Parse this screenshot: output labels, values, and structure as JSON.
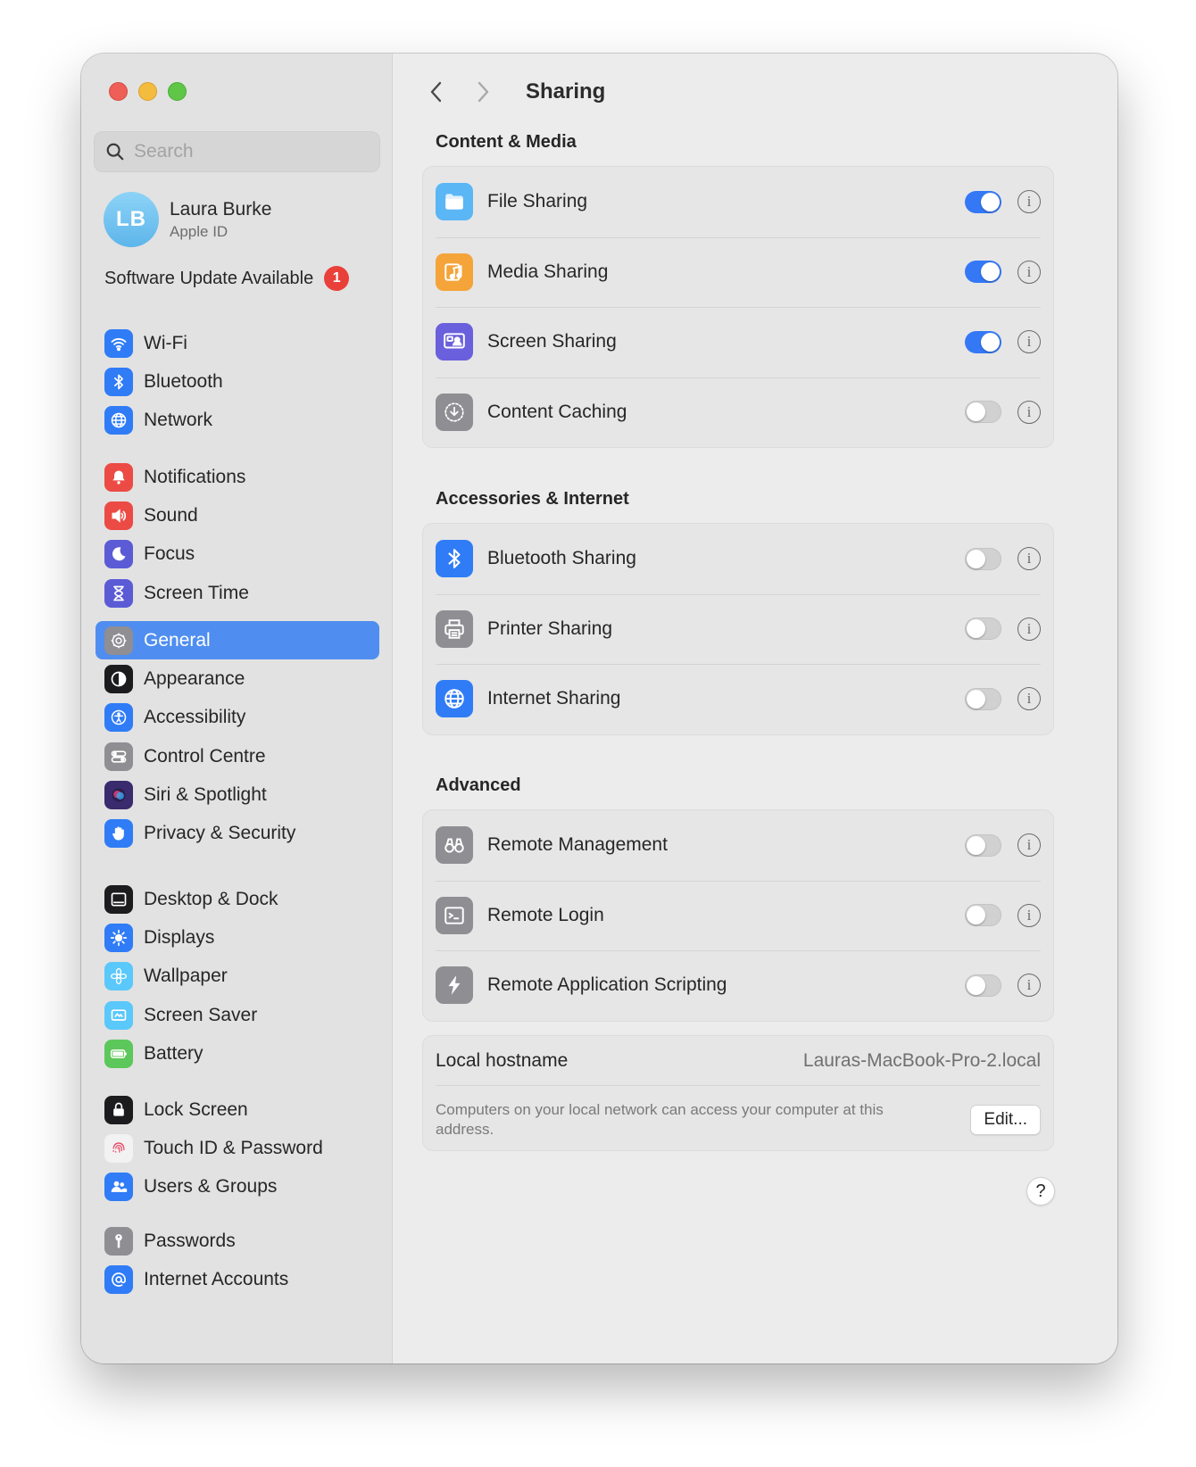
{
  "window": {
    "title": "Sharing"
  },
  "sidebar": {
    "search_placeholder": "Search",
    "profile": {
      "initials": "LB",
      "name": "Laura Burke",
      "subtitle": "Apple ID"
    },
    "update": {
      "label": "Software Update Available",
      "count": "1"
    },
    "groups": [
      [
        {
          "label": "Wi-Fi",
          "icon": "wifi-icon",
          "color": "#2f7cf6"
        },
        {
          "label": "Bluetooth",
          "icon": "bluetooth-icon",
          "color": "#2f7cf6"
        },
        {
          "label": "Network",
          "icon": "globe-icon",
          "color": "#2f7cf6"
        }
      ],
      [
        {
          "label": "Notifications",
          "icon": "bell-icon",
          "color": "#ec4b45"
        },
        {
          "label": "Sound",
          "icon": "speaker-icon",
          "color": "#ec4b45"
        },
        {
          "label": "Focus",
          "icon": "moon-icon",
          "color": "#5b5bd6"
        },
        {
          "label": "Screen Time",
          "icon": "hourglass-icon",
          "color": "#5b5bd6"
        }
      ],
      [
        {
          "label": "General",
          "icon": "gear-icon",
          "color": "#8e8e93",
          "selected": true
        },
        {
          "label": "Appearance",
          "icon": "appearance-icon",
          "color": "#1c1c1e"
        },
        {
          "label": "Accessibility",
          "icon": "accessibility-icon",
          "color": "#2f7cf6"
        },
        {
          "label": "Control Centre",
          "icon": "control-centre-icon",
          "color": "#8e8e93"
        },
        {
          "label": "Siri & Spotlight",
          "icon": "siri-icon",
          "color": "#3a2a6e"
        },
        {
          "label": "Privacy & Security",
          "icon": "hand-icon",
          "color": "#2f7cf6"
        }
      ],
      [
        {
          "label": "Desktop & Dock",
          "icon": "dock-icon",
          "color": "#1c1c1e"
        },
        {
          "label": "Displays",
          "icon": "sun-icon",
          "color": "#2f7cf6"
        },
        {
          "label": "Wallpaper",
          "icon": "flower-icon",
          "color": "#5ac8fa"
        },
        {
          "label": "Screen Saver",
          "icon": "screensaver-icon",
          "color": "#5ac8fa"
        },
        {
          "label": "Battery",
          "icon": "battery-icon",
          "color": "#5cc75a"
        }
      ],
      [
        {
          "label": "Lock Screen",
          "icon": "lock-icon",
          "color": "#1c1c1e"
        },
        {
          "label": "Touch ID & Password",
          "icon": "fingerprint-icon",
          "color": "#f2f2f2"
        },
        {
          "label": "Users & Groups",
          "icon": "users-icon",
          "color": "#2f7cf6"
        }
      ],
      [
        {
          "label": "Passwords",
          "icon": "key-icon",
          "color": "#8e8e93"
        },
        {
          "label": "Internet Accounts",
          "icon": "at-icon",
          "color": "#2f7cf6"
        }
      ]
    ]
  },
  "main": {
    "sections": [
      {
        "title": "Content & Media",
        "rows": [
          {
            "label": "File Sharing",
            "icon": "folder-icon",
            "color": "#5ab6f5",
            "on": true
          },
          {
            "label": "Media Sharing",
            "icon": "music-icon",
            "color": "#f5a43a",
            "on": true
          },
          {
            "label": "Screen Sharing",
            "icon": "screen-share-icon",
            "color": "#6a5fdc",
            "on": true
          },
          {
            "label": "Content Caching",
            "icon": "download-icon",
            "color": "#8e8e93",
            "on": false
          }
        ]
      },
      {
        "title": "Accessories & Internet",
        "rows": [
          {
            "label": "Bluetooth Sharing",
            "icon": "bluetooth-icon",
            "color": "#2f7cf6",
            "on": false
          },
          {
            "label": "Printer Sharing",
            "icon": "printer-icon",
            "color": "#8e8e93",
            "on": false
          },
          {
            "label": "Internet Sharing",
            "icon": "globe-icon",
            "color": "#2f7cf6",
            "on": false
          }
        ]
      },
      {
        "title": "Advanced",
        "rows": [
          {
            "label": "Remote Management",
            "icon": "binoculars-icon",
            "color": "#8e8e93",
            "on": false
          },
          {
            "label": "Remote Login",
            "icon": "terminal-icon",
            "color": "#8e8e93",
            "on": false
          },
          {
            "label": "Remote Application Scripting",
            "icon": "script-icon",
            "color": "#8e8e93",
            "on": false
          }
        ]
      }
    ],
    "hostname": {
      "label": "Local hostname",
      "value": "Lauras-MacBook-Pro-2.local",
      "description": "Computers on your local network can access your computer at this address.",
      "edit_label": "Edit..."
    },
    "help_label": "?"
  }
}
